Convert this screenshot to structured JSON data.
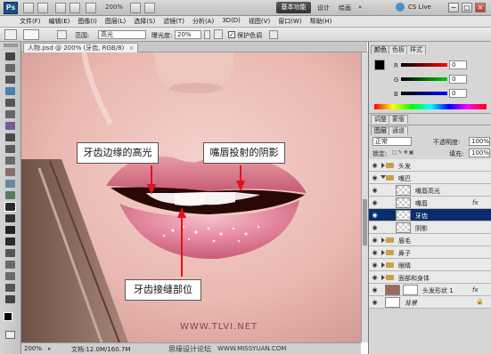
{
  "app": {
    "logo": "Ps",
    "zoom": "200%"
  },
  "workspace": {
    "active": "基本功能",
    "links": [
      "设计",
      "绘画"
    ],
    "cs_live": "CS Live"
  },
  "window_buttons": [
    "−",
    "□",
    "×"
  ],
  "menu": [
    "文件(F)",
    "编辑(E)",
    "图像(I)",
    "图层(L)",
    "选择(S)",
    "滤镜(T)",
    "分析(A)",
    "3D(D)",
    "视图(V)",
    "窗口(W)",
    "帮助(H)"
  ],
  "options": {
    "range_label": "范围:",
    "range_value": "高光",
    "exposure_label": "曝光度:",
    "exposure_value": "20%",
    "protect_label": "保护色调"
  },
  "document": {
    "tab": "人物.psd @ 200% (牙齿, RGB/8)",
    "status_zoom": "200%",
    "status_doc": "文档:12.0M/160.7M"
  },
  "callouts": {
    "highlight": "牙齿边缘的高光",
    "shadow": "嘴唇投射的阴影",
    "gap": "牙齿接缝部位"
  },
  "watermark": {
    "left": "思缘设计论坛",
    "right": "WWW.MISSYUAN.COM",
    "center": "WWW.TLVI.NET"
  },
  "color_panel": {
    "tabs": [
      "颜色",
      "色板",
      "样式"
    ],
    "channels": [
      "R",
      "G",
      "B"
    ],
    "values": [
      "0",
      "0",
      "0"
    ]
  },
  "adjust_tabs": [
    "调整",
    "蒙版"
  ],
  "layers_panel": {
    "tabs": [
      "图层",
      "通道"
    ],
    "blend_mode": "正常",
    "opacity_label": "不透明度:",
    "opacity_value": "100%",
    "lock_label": "锁定:",
    "fill_label": "填充:",
    "fill_value": "100%",
    "layers": [
      {
        "name": "头发",
        "kind": "group",
        "open": false,
        "indent": 0
      },
      {
        "name": "嘴巴",
        "kind": "group",
        "open": true,
        "indent": 0
      },
      {
        "name": "嘴唇高光",
        "kind": "layer",
        "indent": 1
      },
      {
        "name": "嘴唇",
        "kind": "layer",
        "indent": 1,
        "fx": "fx"
      },
      {
        "name": "牙齿",
        "kind": "layer",
        "indent": 1,
        "selected": true
      },
      {
        "name": "阴影",
        "kind": "layer",
        "indent": 1
      },
      {
        "name": "眉毛",
        "kind": "group",
        "open": false,
        "indent": 0
      },
      {
        "name": "鼻子",
        "kind": "group",
        "open": false,
        "indent": 0
      },
      {
        "name": "眼睛",
        "kind": "group",
        "open": false,
        "indent": 0
      },
      {
        "name": "面部和身体",
        "kind": "group",
        "open": false,
        "indent": 0
      },
      {
        "name": "头发形状 1",
        "kind": "shape",
        "indent": 0,
        "fx": "fx"
      },
      {
        "name": "背景",
        "kind": "bg",
        "indent": 0
      }
    ]
  },
  "colors": {
    "selection": "#0b2d6b",
    "workspace_button": "#3a3a3a",
    "arrow": "#e0121e"
  }
}
